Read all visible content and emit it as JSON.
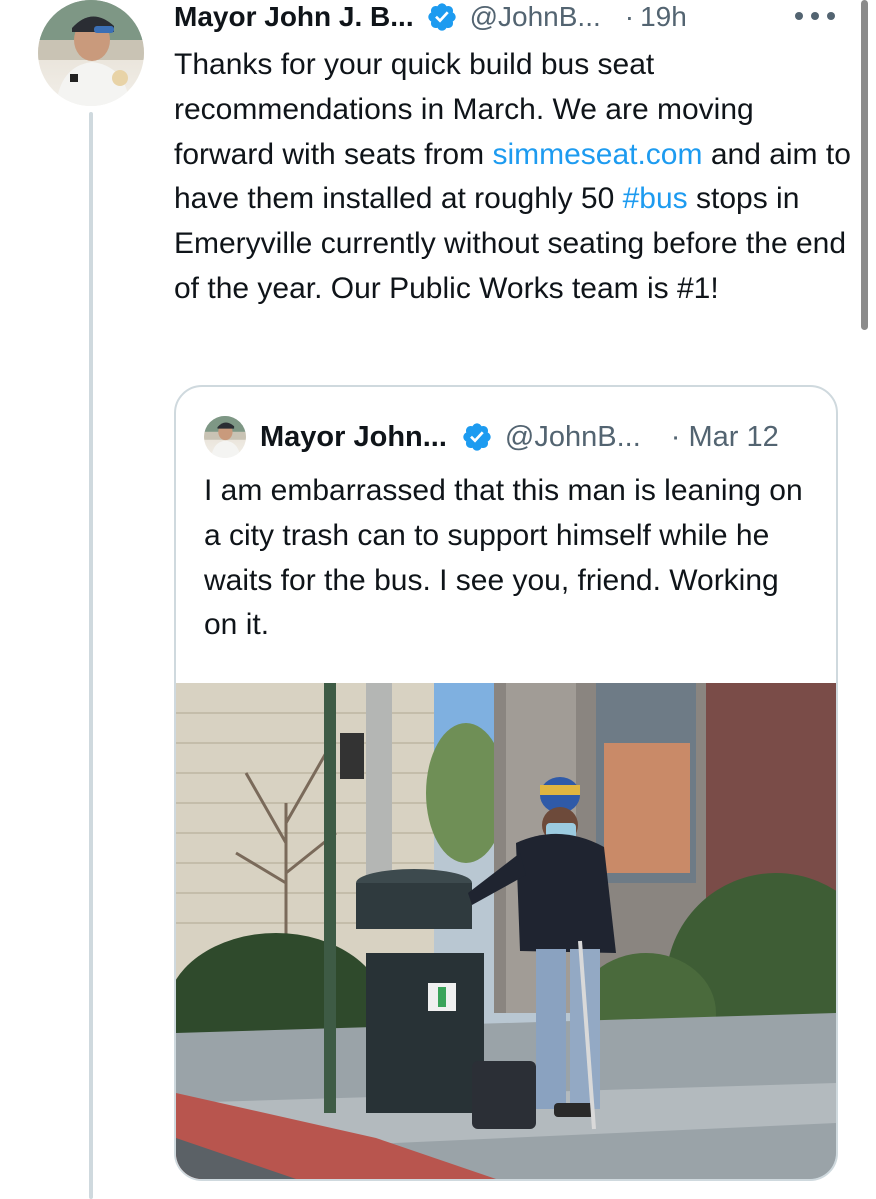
{
  "tweet": {
    "author_name": "Mayor John J. B...",
    "handle": "@JohnB...",
    "separator": "·",
    "time": "19h",
    "text_before_link": "Thanks for your quick build bus seat recommendations in March. We are moving forward with seats from ",
    "link": "simmeseat.com",
    "text_after_link": " and aim to have them installed at roughly 50 ",
    "hashtag": "#bus",
    "text_end": " stops in Emeryville currently without seating before the end of the year. Our Public Works team is #1!",
    "icons": {
      "avatar": "profile-photo",
      "verified": "verified-badge-icon",
      "more": "more-options-icon"
    }
  },
  "quoted_tweet": {
    "author_name": "Mayor John...",
    "handle": "@JohnB...",
    "separator": "·",
    "date": "Mar 12",
    "text": "I am embarrassed that this man is leaning on a city trash can to support himself while he waits for the bus. I see you, friend. Working on it.",
    "image": "photo of a man with a cane leaning on a trash can at a bus stop"
  },
  "colors": {
    "link": "#1d9bf0",
    "secondary_text": "#536471",
    "border": "#cfd9de",
    "verified": "#1d9bf0"
  }
}
